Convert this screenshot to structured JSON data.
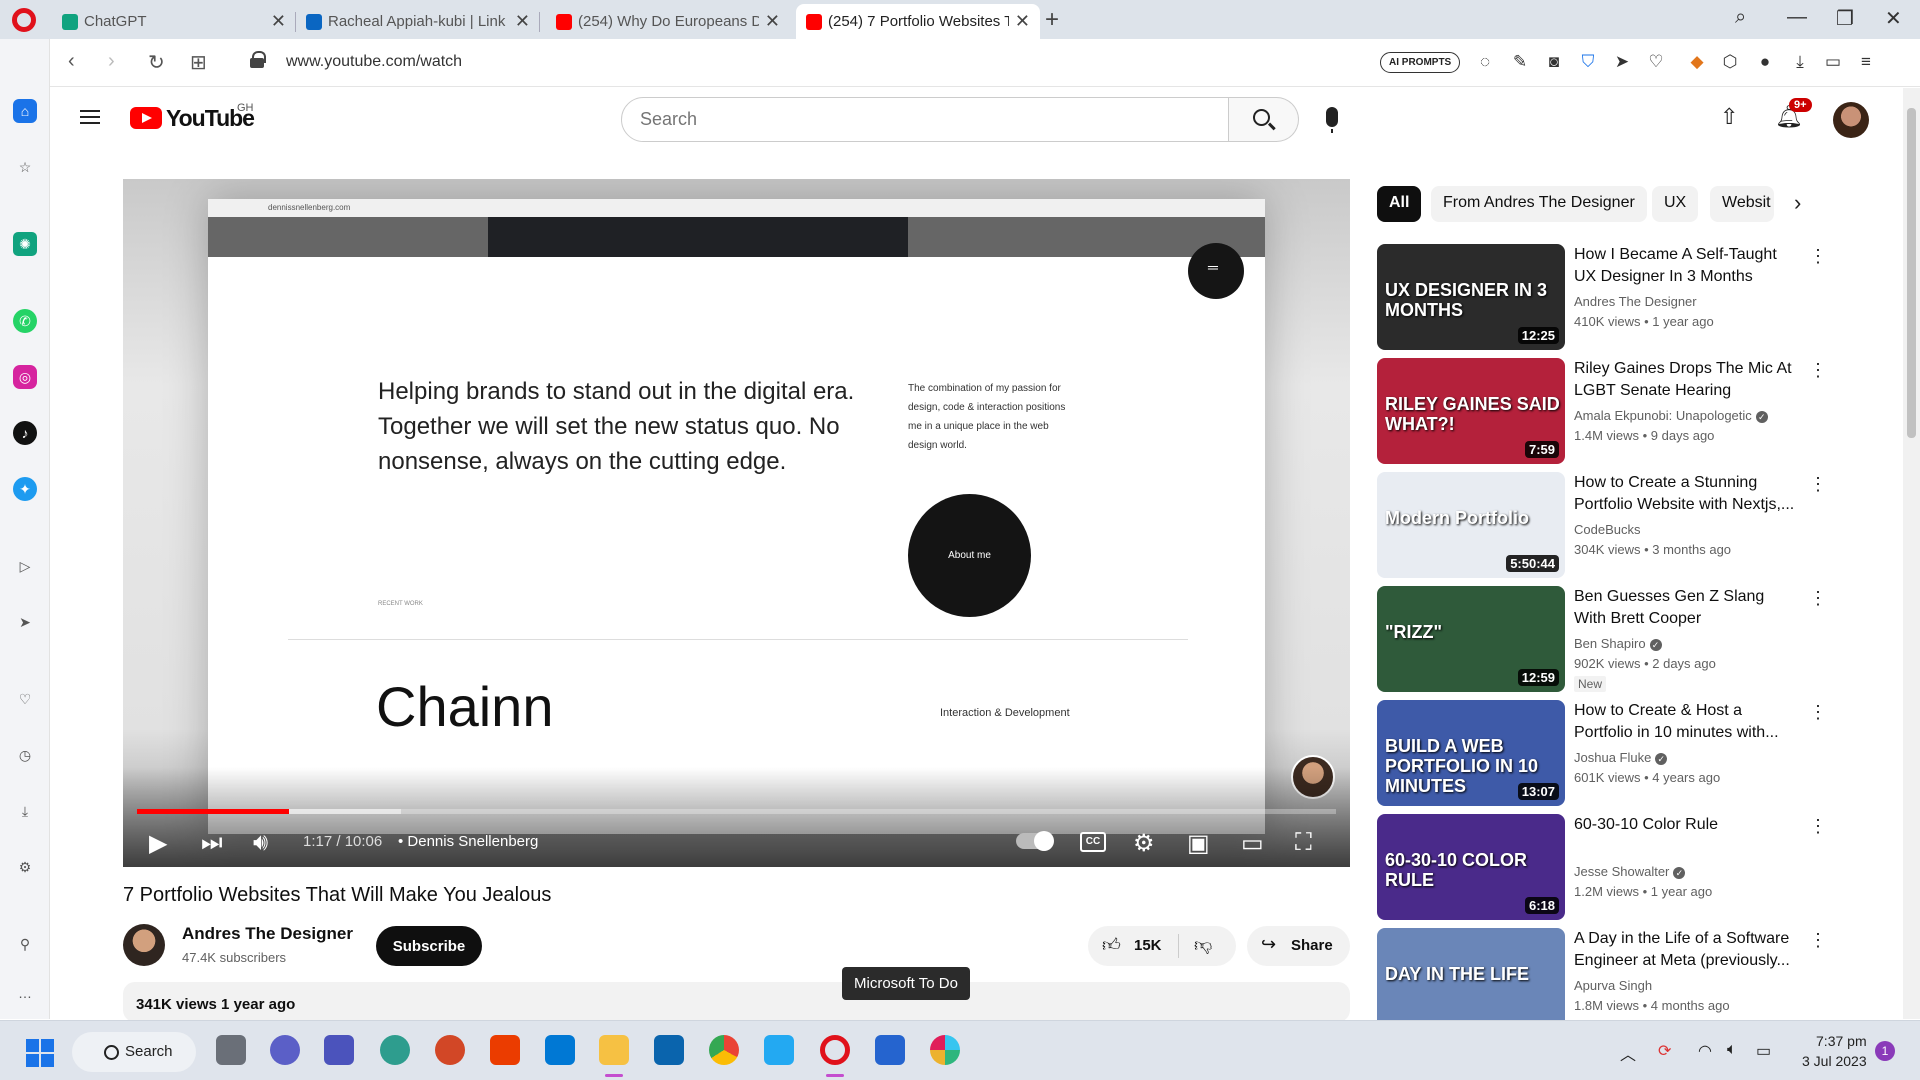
{
  "browser": {
    "tabs": [
      {
        "title": "ChatGPT",
        "color": "#10a37f"
      },
      {
        "title": "Racheal Appiah-kubi | Link",
        "color": "#0a66c2"
      },
      {
        "title": "(254) Why Do Europeans D",
        "color": "#ff0000"
      },
      {
        "title": "(254) 7 Portfolio Websites T",
        "color": "#ff0000"
      }
    ],
    "url": "www.youtube.com/watch",
    "ai_prompts": "AI PROMPTS"
  },
  "youtube": {
    "brand": "YouTube",
    "country": "GH",
    "search_placeholder": "Search",
    "notifications": "9+"
  },
  "player": {
    "screen_url": "dennissnellenberg.com",
    "hero_text": "Helping brands to stand out in the digital era. Together we will set the new status quo. No nonsense, always on the cutting edge.",
    "side_text": "The combination of my passion for design, code & interaction positions me in a unique place in the web design world.",
    "about_label": "About me",
    "recent_label": "RECENT WORK",
    "project_name": "Chainn",
    "project_type": "Interaction & Development",
    "time": "1:17 / 10:06",
    "chapter": "• Dennis Snellenberg",
    "progress_played": 0.127,
    "progress_buffered": 0.22
  },
  "video": {
    "title": "7 Portfolio Websites That Will Make You Jealous",
    "channel": "Andres The Designer",
    "subscribers": "47.4K subscribers",
    "subscribe_label": "Subscribe",
    "likes": "15K",
    "share_label": "Share",
    "description": "341K views  1 year ago"
  },
  "tooltip": "Microsoft To Do",
  "chips": [
    "All",
    "From Andres The Designer",
    "UX",
    "Websit"
  ],
  "related": [
    {
      "title": "How I Became A Self-Taught UX Designer In 3 Months",
      "channel": "Andres The Designer",
      "verified": false,
      "meta": "410K views  • 1 year ago",
      "duration": "12:25",
      "thumb_text": "UX DESIGNER IN 3 MONTHS",
      "thumb_color": "#2b2b2b",
      "badge": ""
    },
    {
      "title": "Riley Gaines Drops The Mic At LGBT Senate Hearing",
      "channel": "Amala Ekpunobi: Unapologetic",
      "verified": true,
      "meta": "1.4M views  • 9 days ago",
      "duration": "7:59",
      "thumb_text": "RILEY GAINES SAID WHAT?!",
      "thumb_color": "#b4213b",
      "badge": ""
    },
    {
      "title": "How to Create a Stunning Portfolio Website with Nextjs,...",
      "channel": "CodeBucks",
      "verified": false,
      "meta": "304K views  • 3 months ago",
      "duration": "5:50:44",
      "thumb_text": "Modern Portfolio",
      "thumb_color": "#e8ecf2",
      "badge": ""
    },
    {
      "title": "Ben Guesses Gen Z Slang With Brett Cooper",
      "channel": "Ben Shapiro",
      "verified": true,
      "meta": "902K views  • 2 days ago",
      "duration": "12:59",
      "thumb_text": "\"RIZZ\"",
      "thumb_color": "#2f5a3a",
      "badge": "New"
    },
    {
      "title": "How to Create & Host a Portfolio in 10 minutes with...",
      "channel": "Joshua Fluke",
      "verified": true,
      "meta": "601K views  • 4 years ago",
      "duration": "13:07",
      "thumb_text": "BUILD A WEB PORTFOLIO IN 10 MINUTES",
      "thumb_color": "#3e5aa8",
      "badge": ""
    },
    {
      "title": "60-30-10 Color Rule",
      "channel": "Jesse Showalter",
      "verified": true,
      "meta": "1.2M views  • 1 year ago",
      "duration": "6:18",
      "thumb_text": "60-30-10 COLOR RULE",
      "thumb_color": "#4a2a8a",
      "badge": ""
    },
    {
      "title": "A Day in the Life of a Software Engineer at Meta (previously...",
      "channel": "Apurva Singh",
      "verified": false,
      "meta": "1.8M views  • 4 months ago",
      "duration": "",
      "thumb_text": "DAY IN THE LIFE",
      "thumb_color": "#6a86b8",
      "badge": ""
    }
  ],
  "taskbar": {
    "search_label": "Search",
    "time": "7:37 pm",
    "date": "3 Jul 2023",
    "badge": "1"
  }
}
